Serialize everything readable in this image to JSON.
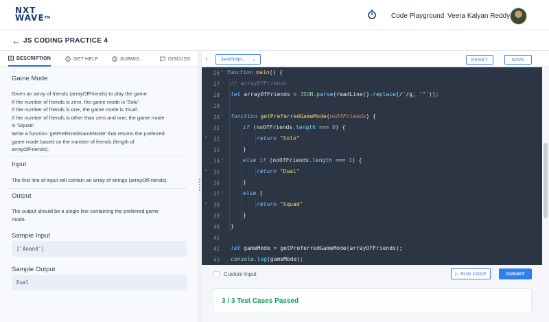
{
  "header": {
    "logo_line1": "NXT",
    "logo_line2": "WAVE",
    "logo_tm": "TM",
    "nav_playground": "Code Playground",
    "user_name": "Veera Kalyan Reddy"
  },
  "title_bar": {
    "title": "JS CODING PRACTICE 4"
  },
  "tabs": [
    {
      "label": "DESCRIPTION",
      "active": true
    },
    {
      "label": "GET HELP",
      "active": false
    },
    {
      "label": "SUBMIS...",
      "active": false
    },
    {
      "label": "DISCUSS",
      "active": false
    }
  ],
  "description": {
    "game_mode_heading": "Game Mode",
    "game_mode_lines": [
      "Given an array of friends (arrayOfFriends) to play the game.",
      "If the number of friends is zero, the game mode is 'Solo'.",
      "If the number of friends is one, the game mode is 'Dual'.",
      "If the number of friends is other than zero and one, the game mode",
      "is 'Squad'.",
      "Write a function 'getPreferredGameMode' that returns the preferred",
      "game mode based on the number of friends (length of",
      "arrayOfFriends)."
    ],
    "input_heading": "Input",
    "input_text": "The first line of input will contain an array of strings (arrayOfFriends).",
    "output_heading": "Output",
    "output_lines": [
      "The output should be a single line containing the preferred game",
      "mode."
    ],
    "sample_input_heading": "Sample Input",
    "sample_input_value": "['Anand']",
    "sample_output_heading": "Sample Output",
    "sample_output_value": "Dual"
  },
  "editor_toolbar": {
    "language": "JavaScript...",
    "reset_label": "RESET",
    "save_label": "SAVE"
  },
  "code_lines": [
    {
      "n": "26",
      "fold": true,
      "marker": false
    },
    {
      "n": "27",
      "fold": false,
      "marker": false
    },
    {
      "n": "28",
      "fold": false,
      "marker": false
    },
    {
      "n": "29",
      "fold": false,
      "marker": false
    },
    {
      "n": "30",
      "fold": true,
      "marker": false
    },
    {
      "n": "31",
      "fold": true,
      "marker": false
    },
    {
      "n": "32",
      "fold": false,
      "marker": true
    },
    {
      "n": "33",
      "fold": false,
      "marker": false
    },
    {
      "n": "34",
      "fold": true,
      "marker": false
    },
    {
      "n": "35",
      "fold": false,
      "marker": true
    },
    {
      "n": "36",
      "fold": false,
      "marker": false
    },
    {
      "n": "37",
      "fold": true,
      "marker": false
    },
    {
      "n": "38",
      "fold": false,
      "marker": true
    },
    {
      "n": "39",
      "fold": false,
      "marker": false
    },
    {
      "n": "40",
      "fold": false,
      "marker": false
    },
    {
      "n": "41",
      "fold": false,
      "marker": false
    },
    {
      "n": "42",
      "fold": false,
      "marker": false
    },
    {
      "n": "43",
      "fold": false,
      "marker": false
    }
  ],
  "code": {
    "l26": {
      "kw": "function",
      "fn": "main",
      "rest": "() {"
    },
    "l27": {
      "comment": "// arrayOfFriends"
    },
    "l28": {
      "kw": "let",
      "var": "arrayOfFriends =",
      "obj": "JSON",
      "m1": ".parse",
      "p1": "(readLine()",
      "m2": ".replace",
      "p2": "(/'/g, ",
      "str": "'\"'",
      "end": "));"
    },
    "l30": {
      "kw": "function",
      "fn": "getPreferredGameMode",
      "open": "(",
      "param": "noOfFriends",
      "close": ") {"
    },
    "l31": {
      "kw": "if",
      "a": "(noOfFriends",
      "prop": ".length",
      "b": "===",
      "num": "0",
      "c": ") {"
    },
    "l32": {
      "kw": "return",
      "str": "\"Solo\""
    },
    "l33": {
      "text": "}"
    },
    "l34": {
      "kw1": "else",
      "kw2": "if",
      "a": "(noOfFriends",
      "prop": ".length",
      "b": "===",
      "num": "1",
      "c": ") {"
    },
    "l35": {
      "kw": "return",
      "str": "\"Dual\""
    },
    "l36": {
      "text": "}"
    },
    "l37": {
      "kw": "else",
      "rest": "{"
    },
    "l38": {
      "kw": "return",
      "str": "\"Squad\""
    },
    "l39": {
      "text": "}"
    },
    "l40": {
      "text": "}"
    },
    "l42": {
      "kw": "let",
      "rest": "gameMode = getPreferredGameMode(arrayOfFriends);"
    },
    "l43": {
      "obj": "console",
      "m": ".log",
      "rest": "(gameMode);"
    }
  },
  "bottom": {
    "custom_input_label": "Custom Input",
    "run_label": "RUN CODE",
    "submit_label": "SUBMIT",
    "result": "3 / 3 Test Cases Passed"
  },
  "colors": {
    "accent": "#2f80ed",
    "success": "#0f9d58",
    "editor_bg": "#2b3544"
  }
}
